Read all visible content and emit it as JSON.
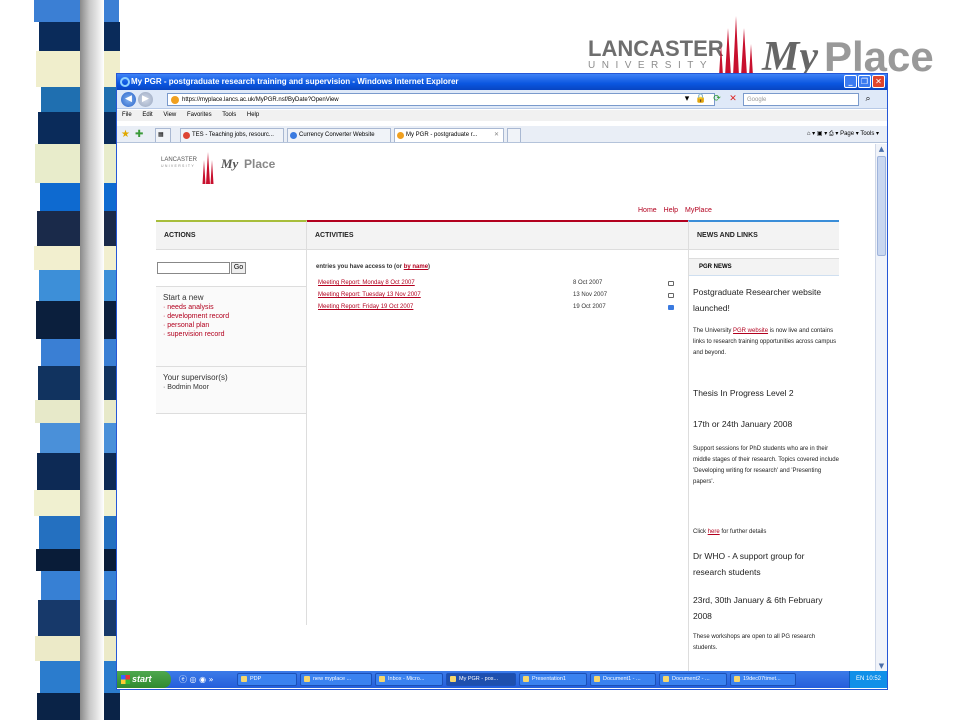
{
  "browser": {
    "title": "My PGR - postgraduate research training and supervision - Windows Internet Explorer",
    "url": "https://myplace.lancs.ac.uk/MyPGR.nsf/ByDate?OpenView",
    "search_placeholder": "Google",
    "menu": [
      "File",
      "Edit",
      "View",
      "Favorites",
      "Tools",
      "Help"
    ],
    "tabs": [
      "TES - Teaching jobs, resourc...",
      "Currency Converter Website",
      "My PGR - postgraduate r..."
    ],
    "tools": "Page ▾  Tools ▾"
  },
  "brand": {
    "line1": "LANCASTER",
    "line2": "UNIVERSITY",
    "my": "My",
    "place": "Place"
  },
  "logo": {
    "line1": "LANCASTER",
    "line2": "UNIVERSITY",
    "my": "My",
    "place": "Place"
  },
  "toplinks": [
    "Home",
    "Help",
    "MyPlace"
  ],
  "actions": {
    "heading": "ACTIONS",
    "go": "Go",
    "start_new": "Start a new",
    "items": [
      "· needs analysis",
      "· development record",
      "· personal plan",
      "· supervision record"
    ],
    "supervisor_heading": "Your supervisor(s)",
    "supervisor": "· Bodmin Moor"
  },
  "activities": {
    "heading": "ACTIVITIES",
    "entries_text": "entries you have access to (or ",
    "by_name": "by name",
    "entries_close": ")",
    "rows": [
      {
        "title": "Meeting Report: Monday 8 Oct 2007",
        "date": "8 Oct 2007"
      },
      {
        "title": "Meeting Report: Tuesday 13 Nov 2007",
        "date": "13 Nov 2007"
      },
      {
        "title": "Meeting Report: Friday 19 Oct 2007",
        "date": "19 Oct 2007"
      }
    ]
  },
  "news": {
    "heading": "NEWS AND LINKS",
    "sub": "PGR NEWS",
    "h1": "Postgraduate Researcher website launched!",
    "p1a": "The University ",
    "p1link": "PGR website",
    "p1b": " is now live and contains links to research training opportunities across campus and beyond.",
    "h2": "Thesis In Progress Level 2",
    "h3": "17th or 24th January 2008",
    "p2": "Support sessions for PhD students who are in their middle stages of their research. Topics covered include 'Developing writing for research' and 'Presenting papers'.",
    "p3a": "Click ",
    "p3link": "here",
    "p3b": " for further details",
    "h4": "Dr WHO - A support group for research students",
    "h5": "23rd, 30th January & 6th February 2008",
    "p4": "These workshops are open to all PG research students."
  },
  "taskbar": {
    "start": "start",
    "items": [
      "PDP",
      "new myplace ...",
      "Inbox - Micro...",
      "My PGR - pos...",
      "Presentation1",
      "Document1 - ...",
      "Document2 - ...",
      "19dec07timet..."
    ],
    "lang": "EN",
    "time": "10:52"
  },
  "colors": {
    "brand_red": "#b2001e",
    "actions_accent": "#a7bd3a",
    "news_accent": "#3a8dd8"
  }
}
